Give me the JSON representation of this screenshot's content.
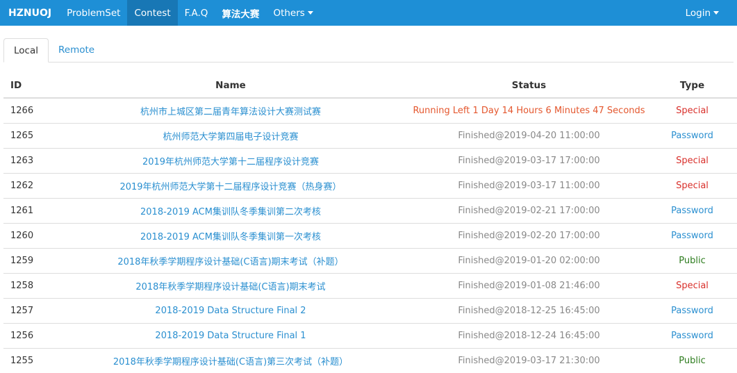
{
  "navbar": {
    "brand": "HZNUOJ",
    "items": [
      {
        "label": "ProblemSet",
        "active": false
      },
      {
        "label": "Contest",
        "active": true
      },
      {
        "label": "F.A.Q",
        "active": false
      },
      {
        "label": "算法大赛",
        "active": false
      },
      {
        "label": "Others",
        "active": false
      }
    ],
    "login": "Login"
  },
  "tabs": [
    "Local",
    "Remote"
  ],
  "table": {
    "headers": {
      "id": "ID",
      "name": "Name",
      "status": "Status",
      "type": "Type"
    },
    "rows": [
      {
        "id": "1266",
        "name": "杭州市上城区第二届青年算法设计大赛测试赛",
        "status": "Running Left 1 Day 14 Hours 6 Minutes 47 Seconds",
        "running": true,
        "type": "Special"
      },
      {
        "id": "1265",
        "name": "杭州师范大学第四届电子设计竞赛",
        "status": "Finished@2019-04-20 11:00:00",
        "running": false,
        "type": "Password"
      },
      {
        "id": "1263",
        "name": "2019年杭州师范大学第十二届程序设计竞赛",
        "status": "Finished@2019-03-17 17:00:00",
        "running": false,
        "type": "Special"
      },
      {
        "id": "1262",
        "name": "2019年杭州师范大学第十二届程序设计竞赛（热身赛）",
        "status": "Finished@2019-03-17 11:00:00",
        "running": false,
        "type": "Special"
      },
      {
        "id": "1261",
        "name": "2018-2019 ACM集训队冬季集训第二次考核",
        "status": "Finished@2019-02-21 17:00:00",
        "running": false,
        "type": "Password"
      },
      {
        "id": "1260",
        "name": "2018-2019 ACM集训队冬季集训第一次考核",
        "status": "Finished@2019-02-20 17:00:00",
        "running": false,
        "type": "Password"
      },
      {
        "id": "1259",
        "name": "2018年秋季学期程序设计基础(C语言)期末考试（补题）",
        "status": "Finished@2019-01-20 02:00:00",
        "running": false,
        "type": "Public"
      },
      {
        "id": "1258",
        "name": "2018年秋季学期程序设计基础(C语言)期末考试",
        "status": "Finished@2019-01-08 21:46:00",
        "running": false,
        "type": "Special"
      },
      {
        "id": "1257",
        "name": "2018-2019 Data Structure Final 2",
        "status": "Finished@2018-12-25 16:45:00",
        "running": false,
        "type": "Password"
      },
      {
        "id": "1256",
        "name": "2018-2019 Data Structure Final 1",
        "status": "Finished@2018-12-24 16:45:00",
        "running": false,
        "type": "Password"
      },
      {
        "id": "1255",
        "name": "2018年秋季学期程序设计基础(C语言)第三次考试（补题）",
        "status": "Finished@2019-03-17 21:30:00",
        "running": false,
        "type": "Public"
      }
    ]
  },
  "colors": {
    "navbar": "#1e8fd6",
    "navbar_active": "#1877b5",
    "link": "#2a8fd0",
    "special": "#d9302b",
    "public": "#2e7d1f",
    "running": "#e4572e"
  }
}
